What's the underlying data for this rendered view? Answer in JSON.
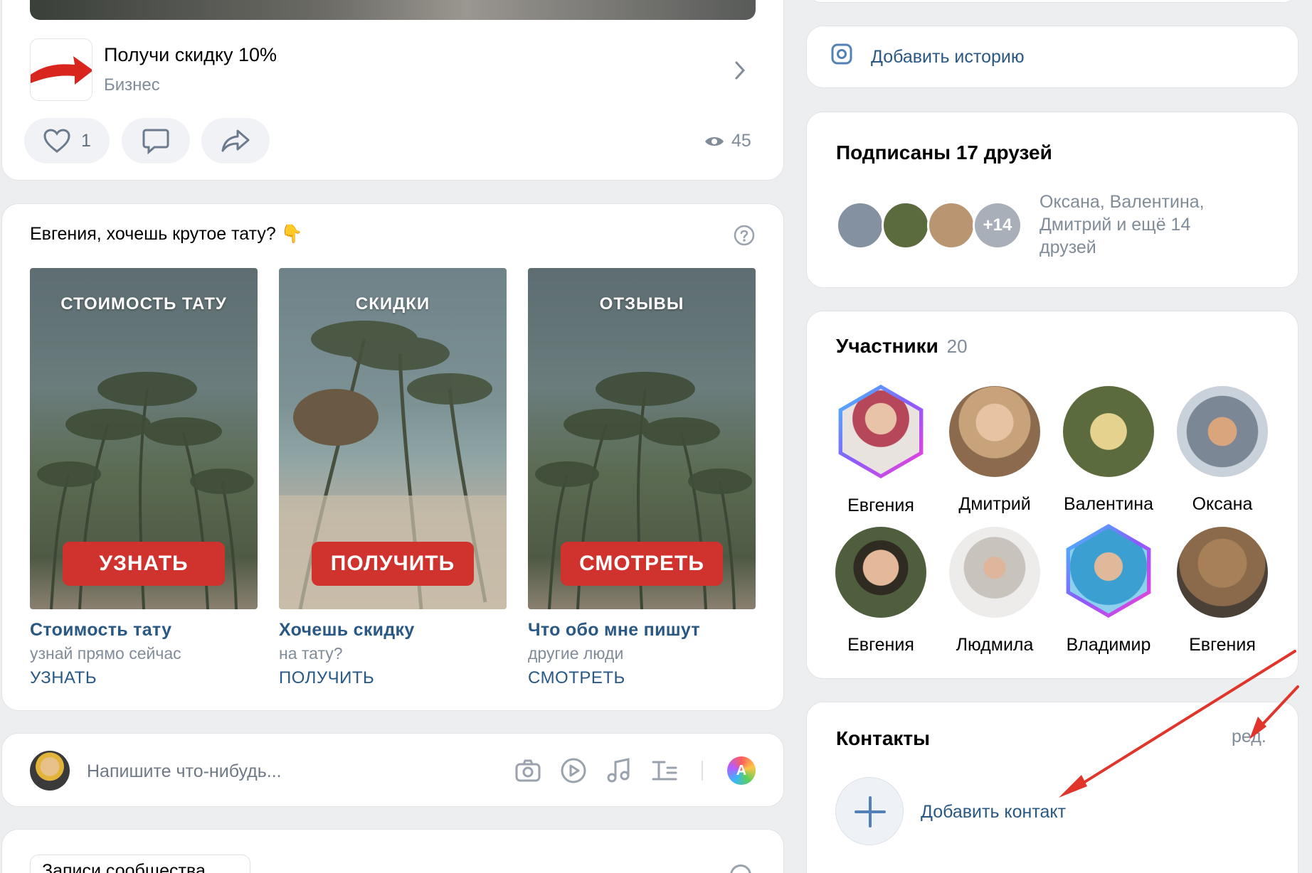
{
  "post": {
    "link_title": "Получи скидку 10%",
    "link_caption": "Бизнес",
    "likes": "1",
    "views": "45"
  },
  "ads": {
    "header": "Евгения, хочешь крутое тату? 👇",
    "items": [
      {
        "image_title": "СТОИМОСТЬ ТАТУ",
        "image_cta": "УЗНАТЬ",
        "title": "Стоимость тату",
        "subtitle": "узнай прямо сейчас",
        "link": "УЗНАТЬ"
      },
      {
        "image_title": "СКИДКИ",
        "image_cta": "ПОЛУЧИТЬ",
        "title": "Хочешь скидку",
        "subtitle": "на тату?",
        "link": "ПОЛУЧИТЬ"
      },
      {
        "image_title": "ОТЗЫВЫ",
        "image_cta": "СМОТРЕТЬ",
        "title": "Что обо мне пишут",
        "subtitle": "другие люди",
        "link": "СМОТРЕТЬ"
      }
    ]
  },
  "composer": {
    "placeholder": "Напишите что-нибудь...",
    "avatar_letter": "A"
  },
  "next_tab": {
    "label": "Записи сообщества"
  },
  "sidebar": {
    "add_story": "Добавить историю",
    "friends": {
      "title": "Подписаны 17 друзей",
      "more_badge": "+14",
      "names": "Оксана, Валентина, Дмитрий и ещё 14 друзей"
    },
    "members": {
      "title": "Участники",
      "count": "20",
      "people": [
        {
          "name": "Евгения",
          "color": "#b6465a"
        },
        {
          "name": "Дмитрий",
          "color": "#c8a27a"
        },
        {
          "name": "Валентина",
          "color": "#5b6b3d"
        },
        {
          "name": "Оксана",
          "color": "#7b8794"
        },
        {
          "name": "Евгения",
          "color": "#4f5e3c"
        },
        {
          "name": "Людмила",
          "color": "#c9c3bd"
        },
        {
          "name": "Владимир",
          "color": "#3b9fd1"
        },
        {
          "name": "Евгения",
          "color": "#8a6a4a"
        }
      ]
    },
    "contacts": {
      "title": "Контакты",
      "edit": "ред.",
      "add": "Добавить контакт"
    }
  },
  "colors": {
    "accent_link": "#2a5885",
    "cta_red": "#d0332e",
    "annotation_arrow": "#e0352b"
  }
}
